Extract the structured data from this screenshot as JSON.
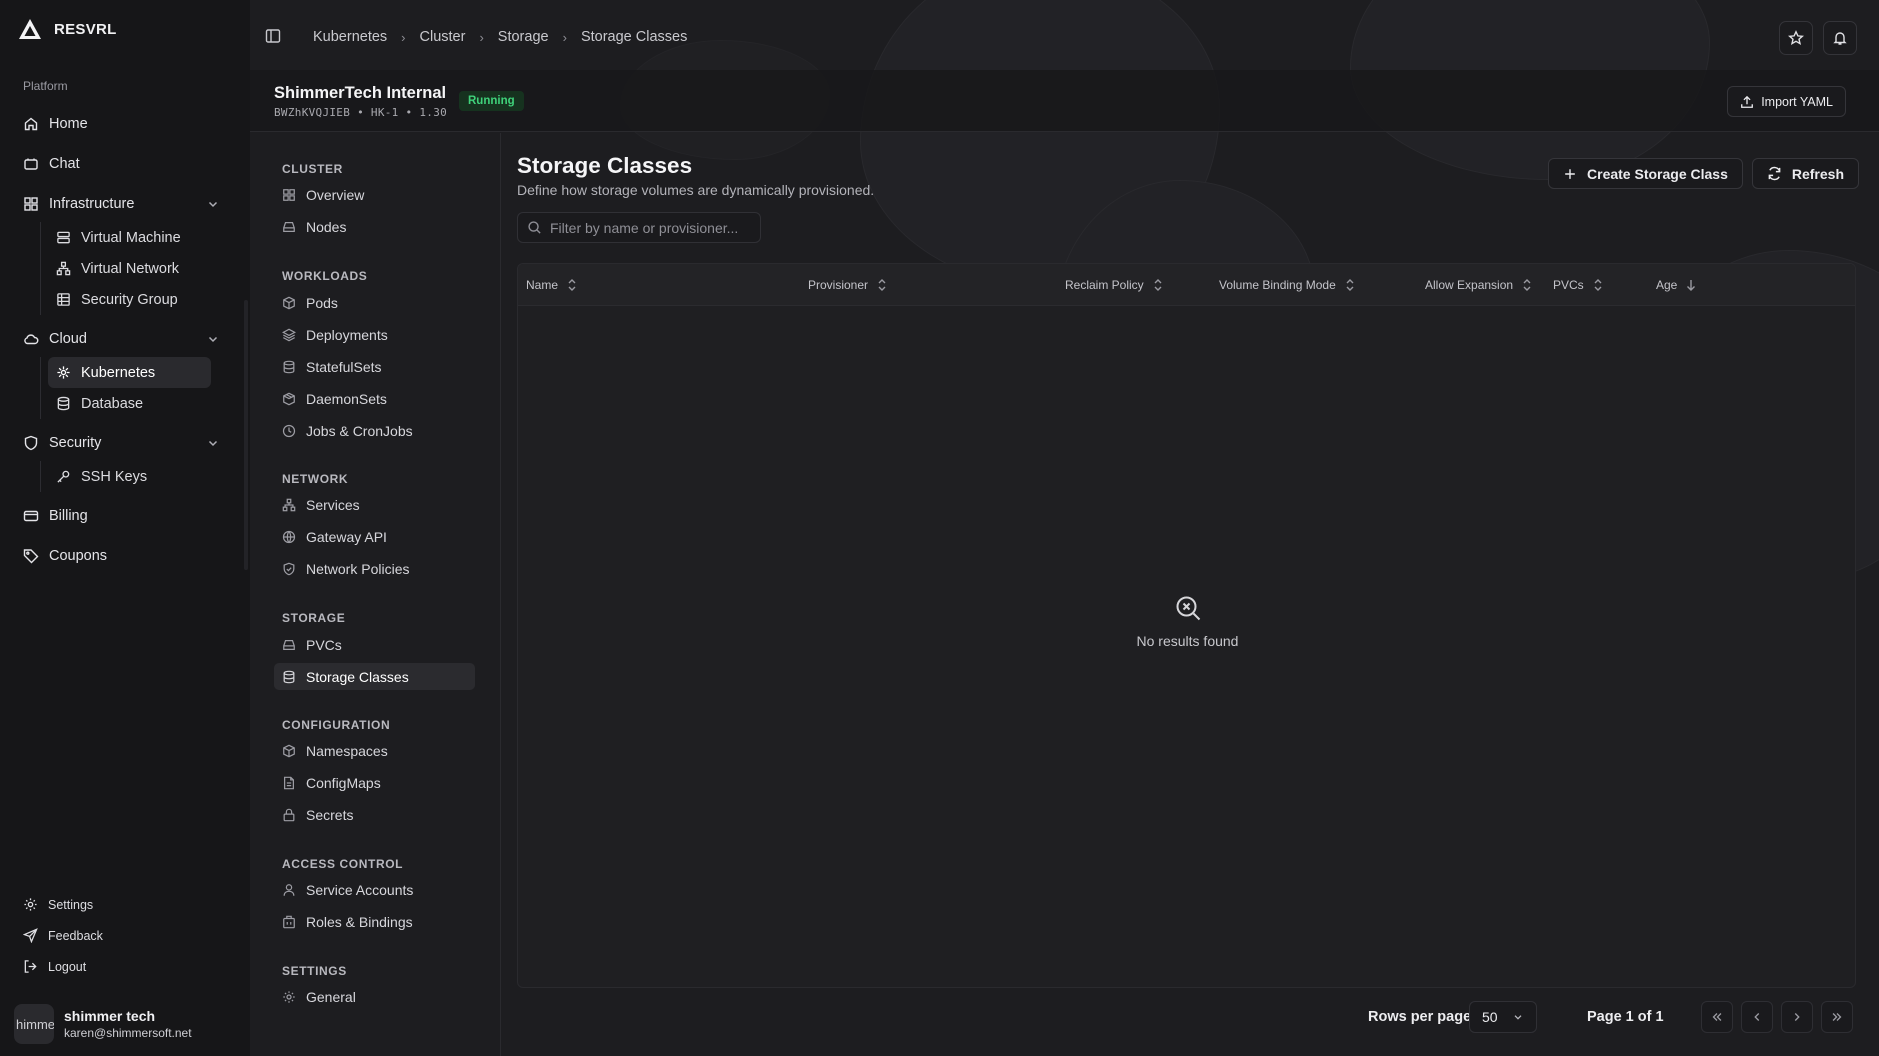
{
  "app": {
    "brand": "RESVRL"
  },
  "sidebar": {
    "section_label": "Platform",
    "items": [
      {
        "label": "Home",
        "icon": "home-icon"
      },
      {
        "label": "Chat",
        "icon": "chat-icon"
      },
      {
        "label": "Infrastructure",
        "icon": "grid-icon",
        "children": [
          "Virtual Machine",
          "Virtual Network",
          "Security Group"
        ]
      },
      {
        "label": "Cloud",
        "icon": "cloud-icon",
        "children": [
          "Kubernetes",
          "Database"
        ]
      },
      {
        "label": "Security",
        "icon": "shield-icon",
        "children": [
          "SSH Keys"
        ]
      },
      {
        "label": "Billing",
        "icon": "card-icon"
      },
      {
        "label": "Coupons",
        "icon": "tag-icon"
      }
    ],
    "active_child": "Kubernetes",
    "bottom": [
      "Settings",
      "Feedback",
      "Logout"
    ],
    "user": {
      "avatar_text": "himme",
      "name": "shimmer tech",
      "email": "karen@shimmersoft.net"
    }
  },
  "breadcrumb": [
    "Kubernetes",
    "Cluster",
    "Storage",
    "Storage Classes"
  ],
  "cluster": {
    "name": "ShimmerTech Internal",
    "meta": "BWZhKVQJIEB  •  HK-1  •  1.30",
    "status": "Running",
    "status_color": "#3fd17a",
    "import_label": "Import YAML"
  },
  "subnav": [
    {
      "group": "CLUSTER",
      "items": [
        "Overview",
        "Nodes"
      ]
    },
    {
      "group": "WORKLOADS",
      "items": [
        "Pods",
        "Deployments",
        "StatefulSets",
        "DaemonSets",
        "Jobs & CronJobs"
      ]
    },
    {
      "group": "NETWORK",
      "items": [
        "Services",
        "Gateway API",
        "Network Policies"
      ]
    },
    {
      "group": "STORAGE",
      "items": [
        "PVCs",
        "Storage Classes"
      ]
    },
    {
      "group": "CONFIGURATION",
      "items": [
        "Namespaces",
        "ConfigMaps",
        "Secrets"
      ]
    },
    {
      "group": "ACCESS CONTROL",
      "items": [
        "Service Accounts",
        "Roles & Bindings"
      ]
    },
    {
      "group": "SETTINGS",
      "items": [
        "General"
      ]
    }
  ],
  "page": {
    "title": "Storage Classes",
    "description": "Define how storage volumes are dynamically provisioned.",
    "create_label": "Create Storage Class",
    "refresh_label": "Refresh",
    "search_placeholder": "Filter by name or provisioner...",
    "columns": [
      "Name",
      "Provisioner",
      "Reclaim Policy",
      "Volume Binding Mode",
      "Allow Expansion",
      "PVCs",
      "Age"
    ],
    "empty_text": "No results found"
  },
  "pagination": {
    "rows_label": "Rows per page",
    "rows_value": "50",
    "page_info": "Page 1 of 1"
  }
}
